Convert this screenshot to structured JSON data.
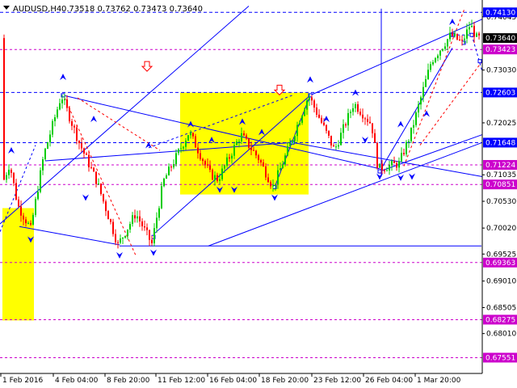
{
  "chart_data": {
    "type": "candlestick",
    "title": "AUDUSD,H4",
    "ohlc_header": "0.73518 0.73762 0.73473 0.73640",
    "ylim": [
      0.6725,
      0.7435
    ],
    "price_ticks": [
      "0.74045",
      "0.73030",
      "0.72025",
      "0.71035",
      "0.70530",
      "0.70020",
      "0.69525",
      "0.69010",
      "0.68505",
      "0.68010"
    ],
    "date_labels": [
      "1 Feb 2016",
      "4 Feb 04:00",
      "8 Feb 20:00",
      "11 Feb 12:00",
      "16 Feb 04:00",
      "18 Feb 20:00",
      "23 Feb 12:00",
      "26 Feb 04:00",
      "1 Mar 20:00"
    ],
    "levels": [
      {
        "value": 0.7413,
        "label": "0.74130",
        "color": "#0000ff"
      },
      {
        "value": 0.7364,
        "label": "0.73640",
        "color": "#000000"
      },
      {
        "value": 0.73423,
        "label": "0.73423",
        "color": "#cc00cc"
      },
      {
        "value": 0.72603,
        "label": "0.72603",
        "color": "#0000ff"
      },
      {
        "value": 0.71648,
        "label": "0.71648",
        "color": "#0000ff"
      },
      {
        "value": 0.71224,
        "label": "0.71224",
        "color": "#cc00cc"
      },
      {
        "value": 0.70851,
        "label": "0.70851",
        "color": "#cc00cc"
      },
      {
        "value": 0.69363,
        "label": "0.69363",
        "color": "#cc00cc"
      },
      {
        "value": 0.68275,
        "label": "0.68275",
        "color": "#cc00cc"
      },
      {
        "value": 0.67551,
        "label": "0.67551",
        "color": "#cc00cc"
      }
    ],
    "colors": {
      "bull": "#00cc00",
      "bear": "#ff0000",
      "box": "#ffff00",
      "levels_solid": "#0000ff",
      "levels_dotted": "#cc00cc",
      "forecast": "#ff0000"
    }
  }
}
